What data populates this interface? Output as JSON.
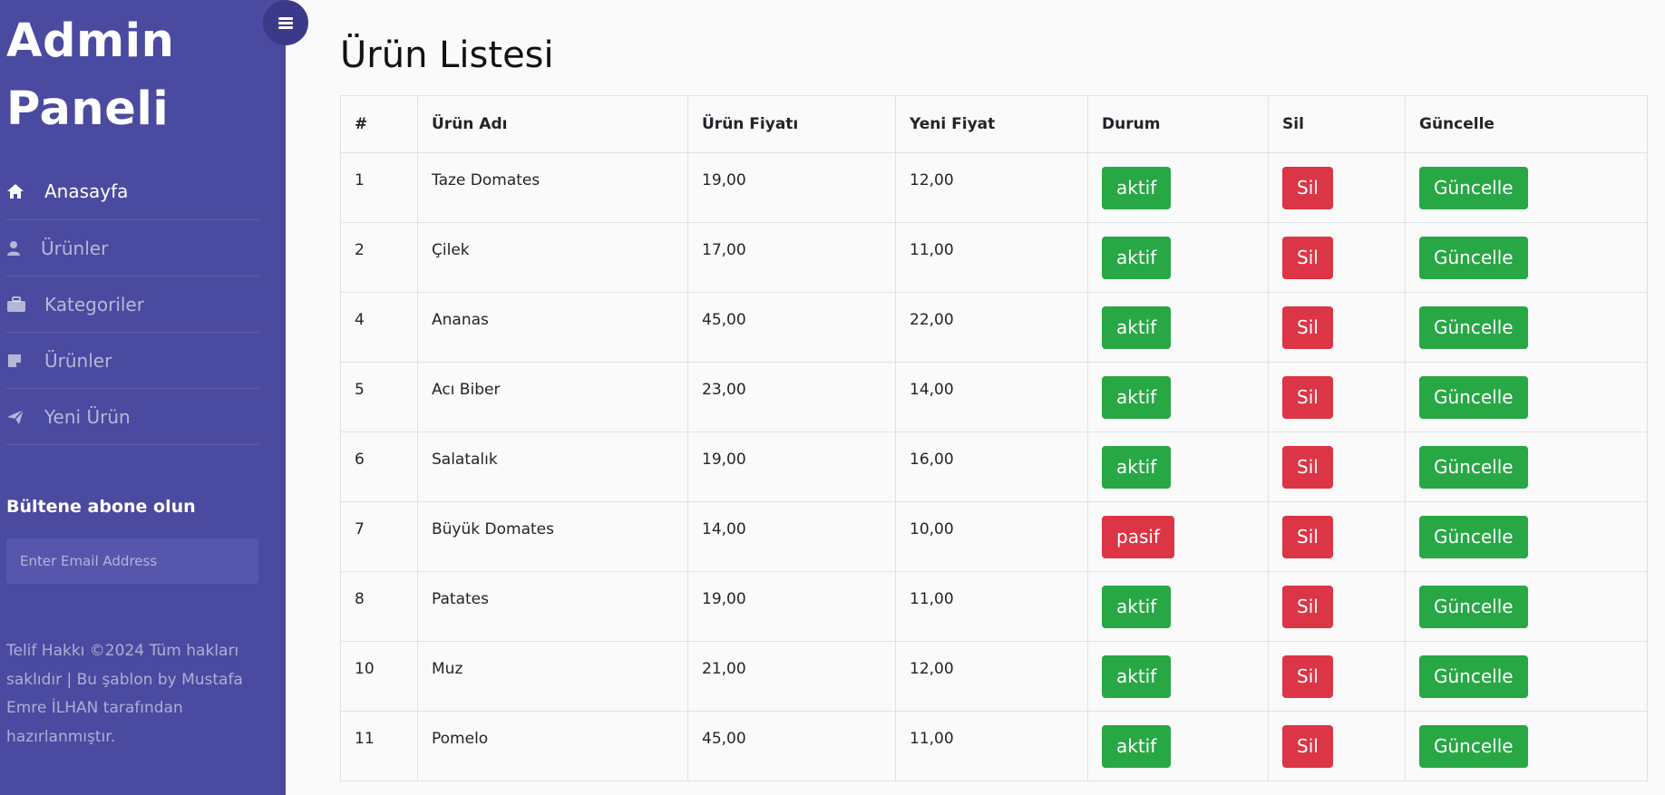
{
  "sidebar": {
    "brand_line1": "Admin",
    "brand_line2": "Paneli",
    "menu": [
      {
        "label": "Anasayfa",
        "icon": "home-icon",
        "active": true
      },
      {
        "label": "Ürünler",
        "icon": "user-icon",
        "active": false
      },
      {
        "label": "Kategoriler",
        "icon": "briefcase-icon",
        "active": false
      },
      {
        "label": "Ürünler",
        "icon": "note-icon",
        "active": false
      },
      {
        "label": "Yeni Ürün",
        "icon": "paper-plane-icon",
        "active": false
      }
    ],
    "newsletter_title": "Bültene abone olun",
    "newsletter_placeholder": "Enter Email Address",
    "copyright": "Telif Hakkı ©2024 Tüm hakları saklıdır | Bu şablon by Mustafa Emre İLHAN tarafından hazırlanmıştır."
  },
  "main": {
    "title": "Ürün Listesi",
    "columns": [
      "#",
      "Ürün Adı",
      "Ürün Fiyatı",
      "Yeni Fiyat",
      "Durum",
      "Sil",
      "Güncelle"
    ],
    "rows": [
      {
        "id": "1",
        "name": "Taze Domates",
        "price": "19,00",
        "new_price": "12,00",
        "status": "aktif",
        "delete": "Sil",
        "update": "Güncelle"
      },
      {
        "id": "2",
        "name": "Çilek",
        "price": "17,00",
        "new_price": "11,00",
        "status": "aktif",
        "delete": "Sil",
        "update": "Güncelle"
      },
      {
        "id": "4",
        "name": "Ananas",
        "price": "45,00",
        "new_price": "22,00",
        "status": "aktif",
        "delete": "Sil",
        "update": "Güncelle"
      },
      {
        "id": "5",
        "name": "Acı Biber",
        "price": "23,00",
        "new_price": "14,00",
        "status": "aktif",
        "delete": "Sil",
        "update": "Güncelle"
      },
      {
        "id": "6",
        "name": "Salatalık",
        "price": "19,00",
        "new_price": "16,00",
        "status": "aktif",
        "delete": "Sil",
        "update": "Güncelle"
      },
      {
        "id": "7",
        "name": "Büyük Domates",
        "price": "14,00",
        "new_price": "10,00",
        "status": "pasif",
        "delete": "Sil",
        "update": "Güncelle"
      },
      {
        "id": "8",
        "name": "Patates",
        "price": "19,00",
        "new_price": "11,00",
        "status": "aktif",
        "delete": "Sil",
        "update": "Güncelle"
      },
      {
        "id": "10",
        "name": "Muz",
        "price": "21,00",
        "new_price": "12,00",
        "status": "aktif",
        "delete": "Sil",
        "update": "Güncelle"
      },
      {
        "id": "11",
        "name": "Pomelo",
        "price": "45,00",
        "new_price": "11,00",
        "status": "aktif",
        "delete": "Sil",
        "update": "Güncelle"
      }
    ]
  },
  "colors": {
    "sidebar_bg": "#4a4aa0",
    "active_green": "#28a745",
    "danger_red": "#dc3545"
  }
}
